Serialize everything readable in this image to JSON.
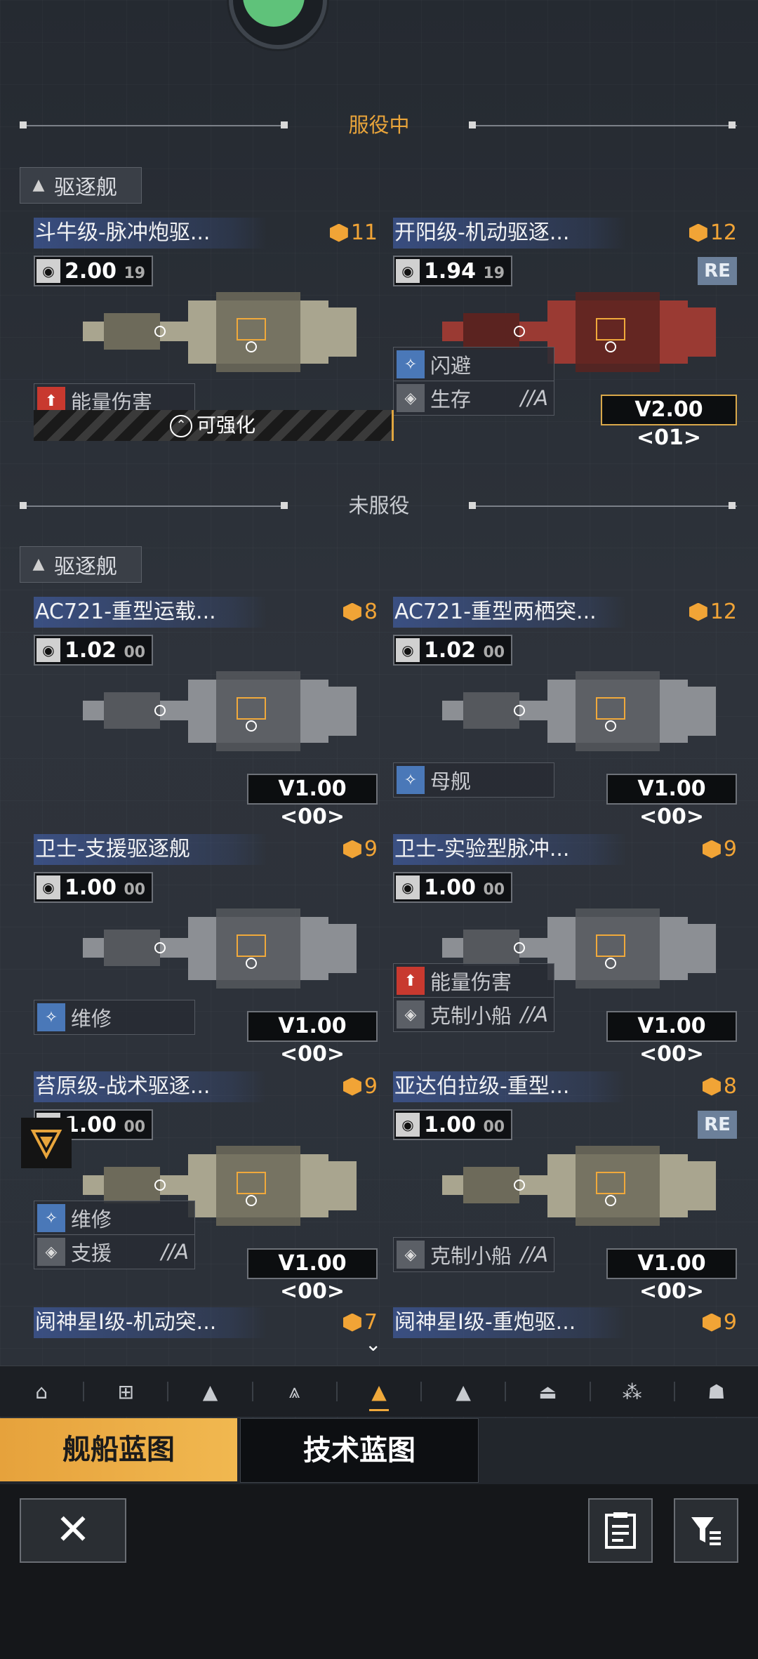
{
  "sections": {
    "active_title": "服役中",
    "inactive_title": "未服役"
  },
  "category": {
    "label": "驱逐舰"
  },
  "active_ships": [
    {
      "name": "斗牛级-脉冲炮驱...",
      "level": "11",
      "version": "2.00",
      "version_sub": "19",
      "tags": [
        {
          "label": "能量伤害",
          "style": "red",
          "grade": ""
        }
      ],
      "upgrade_label": "可强化",
      "badge": "",
      "re": false
    },
    {
      "name": "开阳级-机动驱逐...",
      "level": "12",
      "version": "1.94",
      "version_sub": "19",
      "tags": [
        {
          "label": "闪避",
          "style": "blue",
          "grade": ""
        },
        {
          "label": "生存",
          "style": "grey",
          "grade": "//A"
        }
      ],
      "upgrade_label": "",
      "badge": "V2.00 <01>",
      "re": true
    }
  ],
  "inactive_ships": [
    {
      "name": "AC721-重型运载...",
      "level": "8",
      "version": "1.02",
      "version_sub": "00",
      "tags": [],
      "badge": "V1.00 <00>",
      "re": false
    },
    {
      "name": "AC721-重型两栖突...",
      "level": "12",
      "version": "1.02",
      "version_sub": "00",
      "tags": [
        {
          "label": "母舰",
          "style": "blue",
          "grade": ""
        }
      ],
      "badge": "V1.00 <00>",
      "re": false
    },
    {
      "name": "卫士-支援驱逐舰",
      "level": "9",
      "version": "1.00",
      "version_sub": "00",
      "tags": [
        {
          "label": "维修",
          "style": "blue",
          "grade": ""
        }
      ],
      "badge": "V1.00 <00>",
      "re": false
    },
    {
      "name": "卫士-实验型脉冲...",
      "level": "9",
      "version": "1.00",
      "version_sub": "00",
      "tags": [
        {
          "label": "能量伤害",
          "style": "red",
          "grade": ""
        },
        {
          "label": "克制小船",
          "style": "grey",
          "grade": "//A"
        }
      ],
      "badge": "V1.00 <00>",
      "re": false
    },
    {
      "name": "苔原级-战术驱逐...",
      "level": "9",
      "version": "1.00",
      "version_sub": "00",
      "tags": [
        {
          "label": "维修",
          "style": "blue",
          "grade": ""
        },
        {
          "label": "支援",
          "style": "grey",
          "grade": "//A"
        }
      ],
      "badge": "V1.00 <00>",
      "re": false
    },
    {
      "name": "亚达伯拉级-重型...",
      "level": "8",
      "version": "1.00",
      "version_sub": "00",
      "tags": [
        {
          "label": "克制小船",
          "style": "grey",
          "grade": "//A"
        }
      ],
      "badge": "V1.00 <00>",
      "re": true
    },
    {
      "name": "阋神星Ⅰ级-机动突...",
      "level": "7",
      "version": "",
      "version_sub": "",
      "tags": [],
      "badge": "",
      "re": false
    },
    {
      "name": "阋神星Ⅰ级-重炮驱...",
      "level": "9",
      "version": "",
      "version_sub": "",
      "tags": [],
      "badge": "",
      "re": false
    }
  ],
  "re_label": "RE",
  "nav_icons": [
    "building-icon",
    "carrier-icon",
    "cruiser-icon",
    "frigate-icon",
    "destroyer-icon",
    "corvette-icon",
    "platform-icon",
    "fighter-icon",
    "dome-icon"
  ],
  "tabs": {
    "ship_blueprint": "舰船蓝图",
    "tech_blueprint": "技术蓝图"
  },
  "colors": {
    "accent": "#f0a93b",
    "name_bar": "#4668be",
    "tag_red": "#c8392f",
    "tag_blue": "#4a78b8"
  }
}
